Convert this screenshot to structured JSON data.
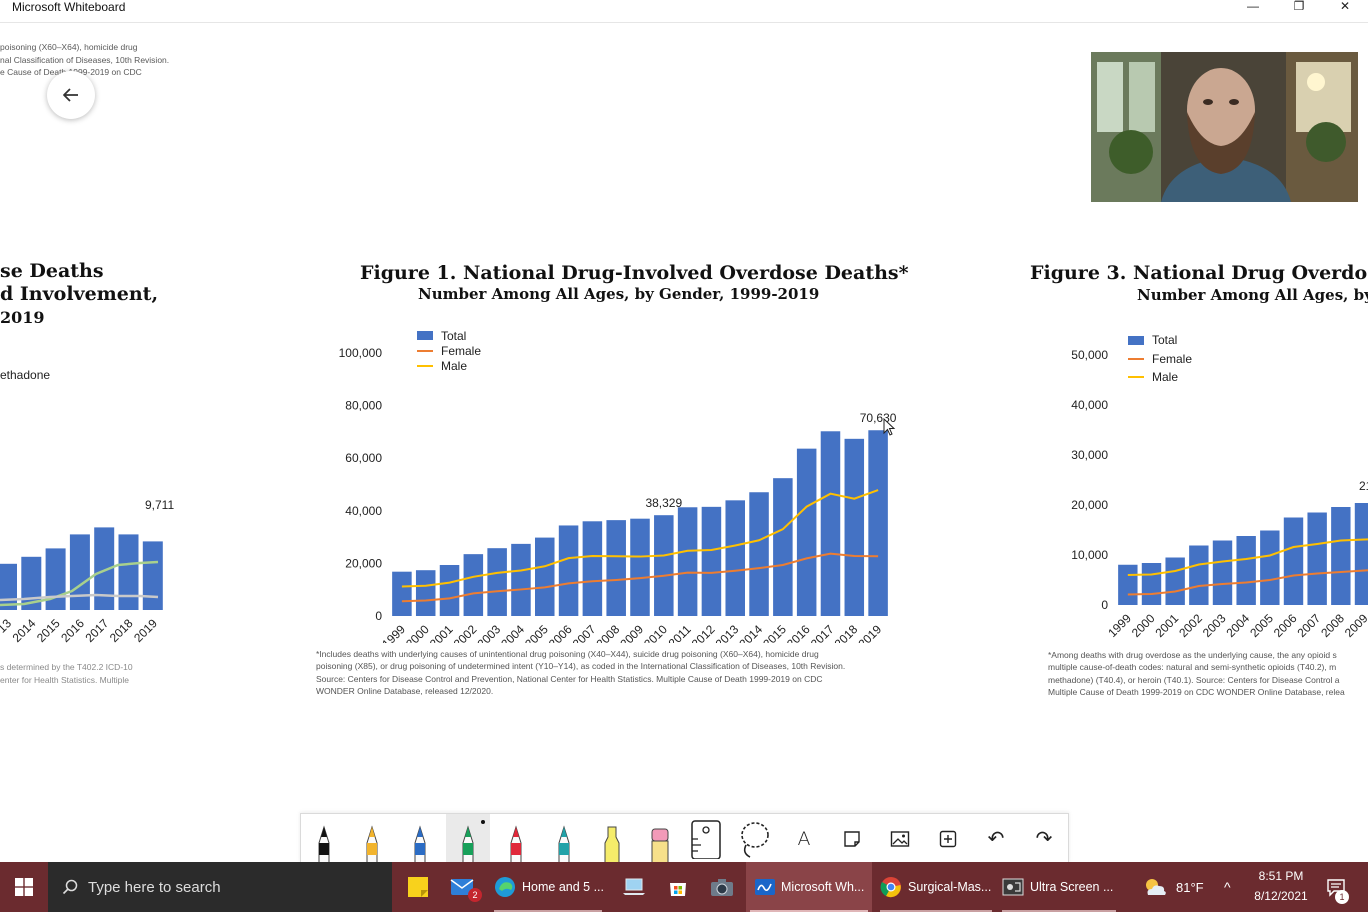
{
  "window": {
    "title": "Microsoft Whiteboard",
    "minimize_glyph": "—",
    "restore_glyph": "❐",
    "close_glyph": "✕"
  },
  "left_panel": {
    "top_note_lines": [
      "poisoning (X60–X64), homicide drug",
      "nal Classification of Diseases, 10th Revision.",
      "e Cause of Death 1999-2019 on CDC"
    ],
    "title_lines": [
      "se Deaths",
      "d Involvement,",
      "2019"
    ],
    "legend_label": "ethadone",
    "data_label": "9,711",
    "x_labels": [
      "13",
      "2014",
      "2015",
      "2016",
      "2017",
      "2018",
      "2019"
    ],
    "bar_values_rel": [
      0.33,
      0.38,
      0.44,
      0.54,
      0.59,
      0.54,
      0.49
    ],
    "footnote_lines": [
      "s determined by the T402.2 ICD-10",
      "enter for Health Statistics. Multiple"
    ]
  },
  "figure1": {
    "title": "Figure 1. National Drug-Involved Overdose Deaths*",
    "subtitle": "Number Among All Ages, by Gender, 1999-2019",
    "legend": [
      "Total",
      "Female",
      "Male"
    ],
    "annotations": [
      "38,329",
      "70,630"
    ],
    "footnote_lines": [
      "*Includes deaths with underlying causes of unintentional drug poisoning (X40–X44), suicide drug poisoning (X60–X64), homicide drug",
      "poisoning (X85), or drug poisoning of undetermined intent (Y10–Y14), as coded in the International Classification of Diseases, 10th Revision.",
      "Source: Centers for Disease Control and Prevention, National Center for Health Statistics. Multiple Cause of Death 1999-2019 on CDC",
      "WONDER Online Database, released 12/2020."
    ]
  },
  "figure3": {
    "title": "Figure 3. National Drug Overdose De",
    "subtitle": "Number Among All Ages, by",
    "legend": [
      "Total",
      "Female",
      "Male"
    ],
    "partial_label": "21",
    "footnote_lines": [
      "*Among deaths with drug overdose as the underlying cause, the any opioid s",
      "multiple cause-of-death codes: natural and semi-synthetic opioids (T40.2), m",
      "methadone) (T40.4), or heroin (T40.1).  Source: Centers for Disease Control a",
      "Multiple Cause of Death 1999-2019 on CDC WONDER Online Database, relea"
    ]
  },
  "chart_data": [
    {
      "type": "bar",
      "title": "Figure 1. National Drug-Involved Overdose Deaths*",
      "subtitle": "Number Among All Ages, by Gender, 1999-2019",
      "categories": [
        "1999",
        "2000",
        "2001",
        "2002",
        "2003",
        "2004",
        "2005",
        "2006",
        "2007",
        "2008",
        "2009",
        "2010",
        "2011",
        "2012",
        "2013",
        "2014",
        "2015",
        "2016",
        "2017",
        "2018",
        "2019"
      ],
      "ylim": [
        0,
        100000
      ],
      "yticks": [
        "0",
        "20,000",
        "40,000",
        "60,000",
        "80,000",
        "100,000"
      ],
      "series": [
        {
          "name": "Total",
          "type": "bar",
          "color": "#4472c4",
          "values": [
            16849,
            17415,
            19394,
            23518,
            25785,
            27424,
            29813,
            34425,
            36010,
            36450,
            37004,
            38329,
            41340,
            41502,
            43982,
            47055,
            52404,
            63632,
            70237,
            67367,
            70630
          ]
        },
        {
          "name": "Female",
          "type": "line",
          "color": "#ed7d31",
          "values": [
            5600,
            5900,
            6700,
            8600,
            9400,
            10100,
            10900,
            12400,
            13200,
            13700,
            14400,
            15300,
            16500,
            16400,
            17200,
            18200,
            19400,
            21900,
            23700,
            22800,
            22700
          ]
        },
        {
          "name": "Male",
          "type": "line",
          "color": "#ffc000",
          "values": [
            11200,
            11500,
            12700,
            14900,
            16400,
            17300,
            18900,
            22000,
            22800,
            22700,
            22600,
            23000,
            24800,
            25100,
            26800,
            28800,
            33000,
            41600,
            46500,
            44600,
            47900
          ]
        }
      ],
      "data_labels": [
        {
          "category": "2010",
          "text": "38,329"
        },
        {
          "category": "2019",
          "text": "70,630"
        }
      ],
      "legend_position": "top-left"
    },
    {
      "type": "bar",
      "title": "Figure 3. National Drug Overdose De",
      "subtitle": "Number Among All Ages, by",
      "categories": [
        "1999",
        "2000",
        "2001",
        "2002",
        "2003",
        "2004",
        "2005",
        "2006",
        "2007",
        "2008",
        "2009",
        "20"
      ],
      "ylim": [
        0,
        50000
      ],
      "yticks": [
        "0",
        "10,000",
        "20,000",
        "30,000",
        "40,000",
        "50,000"
      ],
      "series": [
        {
          "name": "Total",
          "type": "bar",
          "color": "#4472c4",
          "values": [
            8050,
            8400,
            9500,
            11900,
            12900,
            13800,
            14900,
            17500,
            18500,
            19600,
            20400,
            21000
          ]
        },
        {
          "name": "Female",
          "type": "line",
          "color": "#ed7d31",
          "values": [
            2100,
            2200,
            2700,
            3800,
            4200,
            4500,
            5000,
            5900,
            6300,
            6600,
            6900,
            7200
          ]
        },
        {
          "name": "Male",
          "type": "line",
          "color": "#ffc000",
          "values": [
            6000,
            6100,
            6800,
            8100,
            8700,
            9200,
            9900,
            11600,
            12200,
            12900,
            13100,
            13300
          ]
        }
      ],
      "legend_position": "top-left"
    }
  ],
  "toolbar": {
    "tools": [
      {
        "name": "black-pen-tool",
        "color": "#111111"
      },
      {
        "name": "yellow-pen-tool",
        "color": "#f2b42d"
      },
      {
        "name": "blue-pen-tool",
        "color": "#2b6cc4"
      },
      {
        "name": "green-pen-tool",
        "color": "#18a05a"
      },
      {
        "name": "red-pen-tool",
        "color": "#e0283a"
      },
      {
        "name": "teal-pen-tool",
        "color": "#22a2a8"
      },
      {
        "name": "highlighter-tool",
        "color": "#f5ec6a"
      },
      {
        "name": "eraser-tool",
        "color": "#f29ab8"
      }
    ],
    "selected_tool": "green-pen-tool",
    "text_glyph": "A",
    "undo_glyph": "↶",
    "redo_glyph": "↷"
  },
  "taskbar": {
    "search_placeholder": "Type here to search",
    "mail_badge": "2",
    "apps": [
      {
        "label": "Home and 5 ...",
        "icon": "edge-icon"
      },
      {
        "label": "Microsoft Wh...",
        "icon": "whiteboard-icon"
      },
      {
        "label": "Surgical-Mas...",
        "icon": "chrome-icon"
      },
      {
        "label": "Ultra Screen ...",
        "icon": "screen-recorder-icon"
      }
    ],
    "weather": "81°F",
    "caret": "^",
    "time": "8:51 PM",
    "date": "8/12/2021",
    "notification_count": "1"
  }
}
